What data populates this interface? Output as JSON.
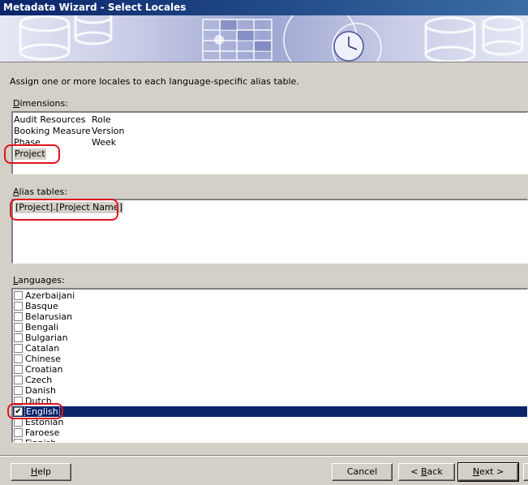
{
  "window": {
    "title": "Metadata Wizard - Select Locales"
  },
  "instruction": "Assign one or more locales to each language-specific alias table.",
  "dimensions": {
    "label_accel": "D",
    "label_rest": "imensions:",
    "col1": [
      "Audit Resources",
      "Booking Measure",
      "Phase",
      "Project"
    ],
    "col2": [
      "Role",
      "Version",
      "Week"
    ],
    "selected": "Project"
  },
  "alias_tables": {
    "label_accel": "A",
    "label_rest": "lias tables:",
    "items": [
      "[Project].[Project Name]"
    ]
  },
  "languages": {
    "label_accel": "L",
    "label_rest": "anguages:",
    "items": [
      {
        "name": "Azerbaijani",
        "checked": false
      },
      {
        "name": "Basque",
        "checked": false
      },
      {
        "name": "Belarusian",
        "checked": false
      },
      {
        "name": "Bengali",
        "checked": false
      },
      {
        "name": "Bulgarian",
        "checked": false
      },
      {
        "name": "Catalan",
        "checked": false
      },
      {
        "name": "Chinese",
        "checked": false
      },
      {
        "name": "Croatian",
        "checked": false
      },
      {
        "name": "Czech",
        "checked": false
      },
      {
        "name": "Danish",
        "checked": false
      },
      {
        "name": "Dutch",
        "checked": false
      },
      {
        "name": "English",
        "checked": true
      },
      {
        "name": "Estonian",
        "checked": false
      },
      {
        "name": "Faroese",
        "checked": false
      },
      {
        "name": "Finnish",
        "checked": false
      }
    ],
    "selected": "English"
  },
  "buttons": {
    "help_accel": "H",
    "help_rest": "elp",
    "cancel": "Cancel",
    "back_prefix": "< ",
    "back_accel": "B",
    "back_rest": "ack",
    "next_accel": "N",
    "next_rest": "ext >"
  },
  "colors": {
    "titlebar": "#0a246a",
    "selection": "#0a246a",
    "annotation": "#e0141e",
    "face": "#d4d0c8"
  }
}
